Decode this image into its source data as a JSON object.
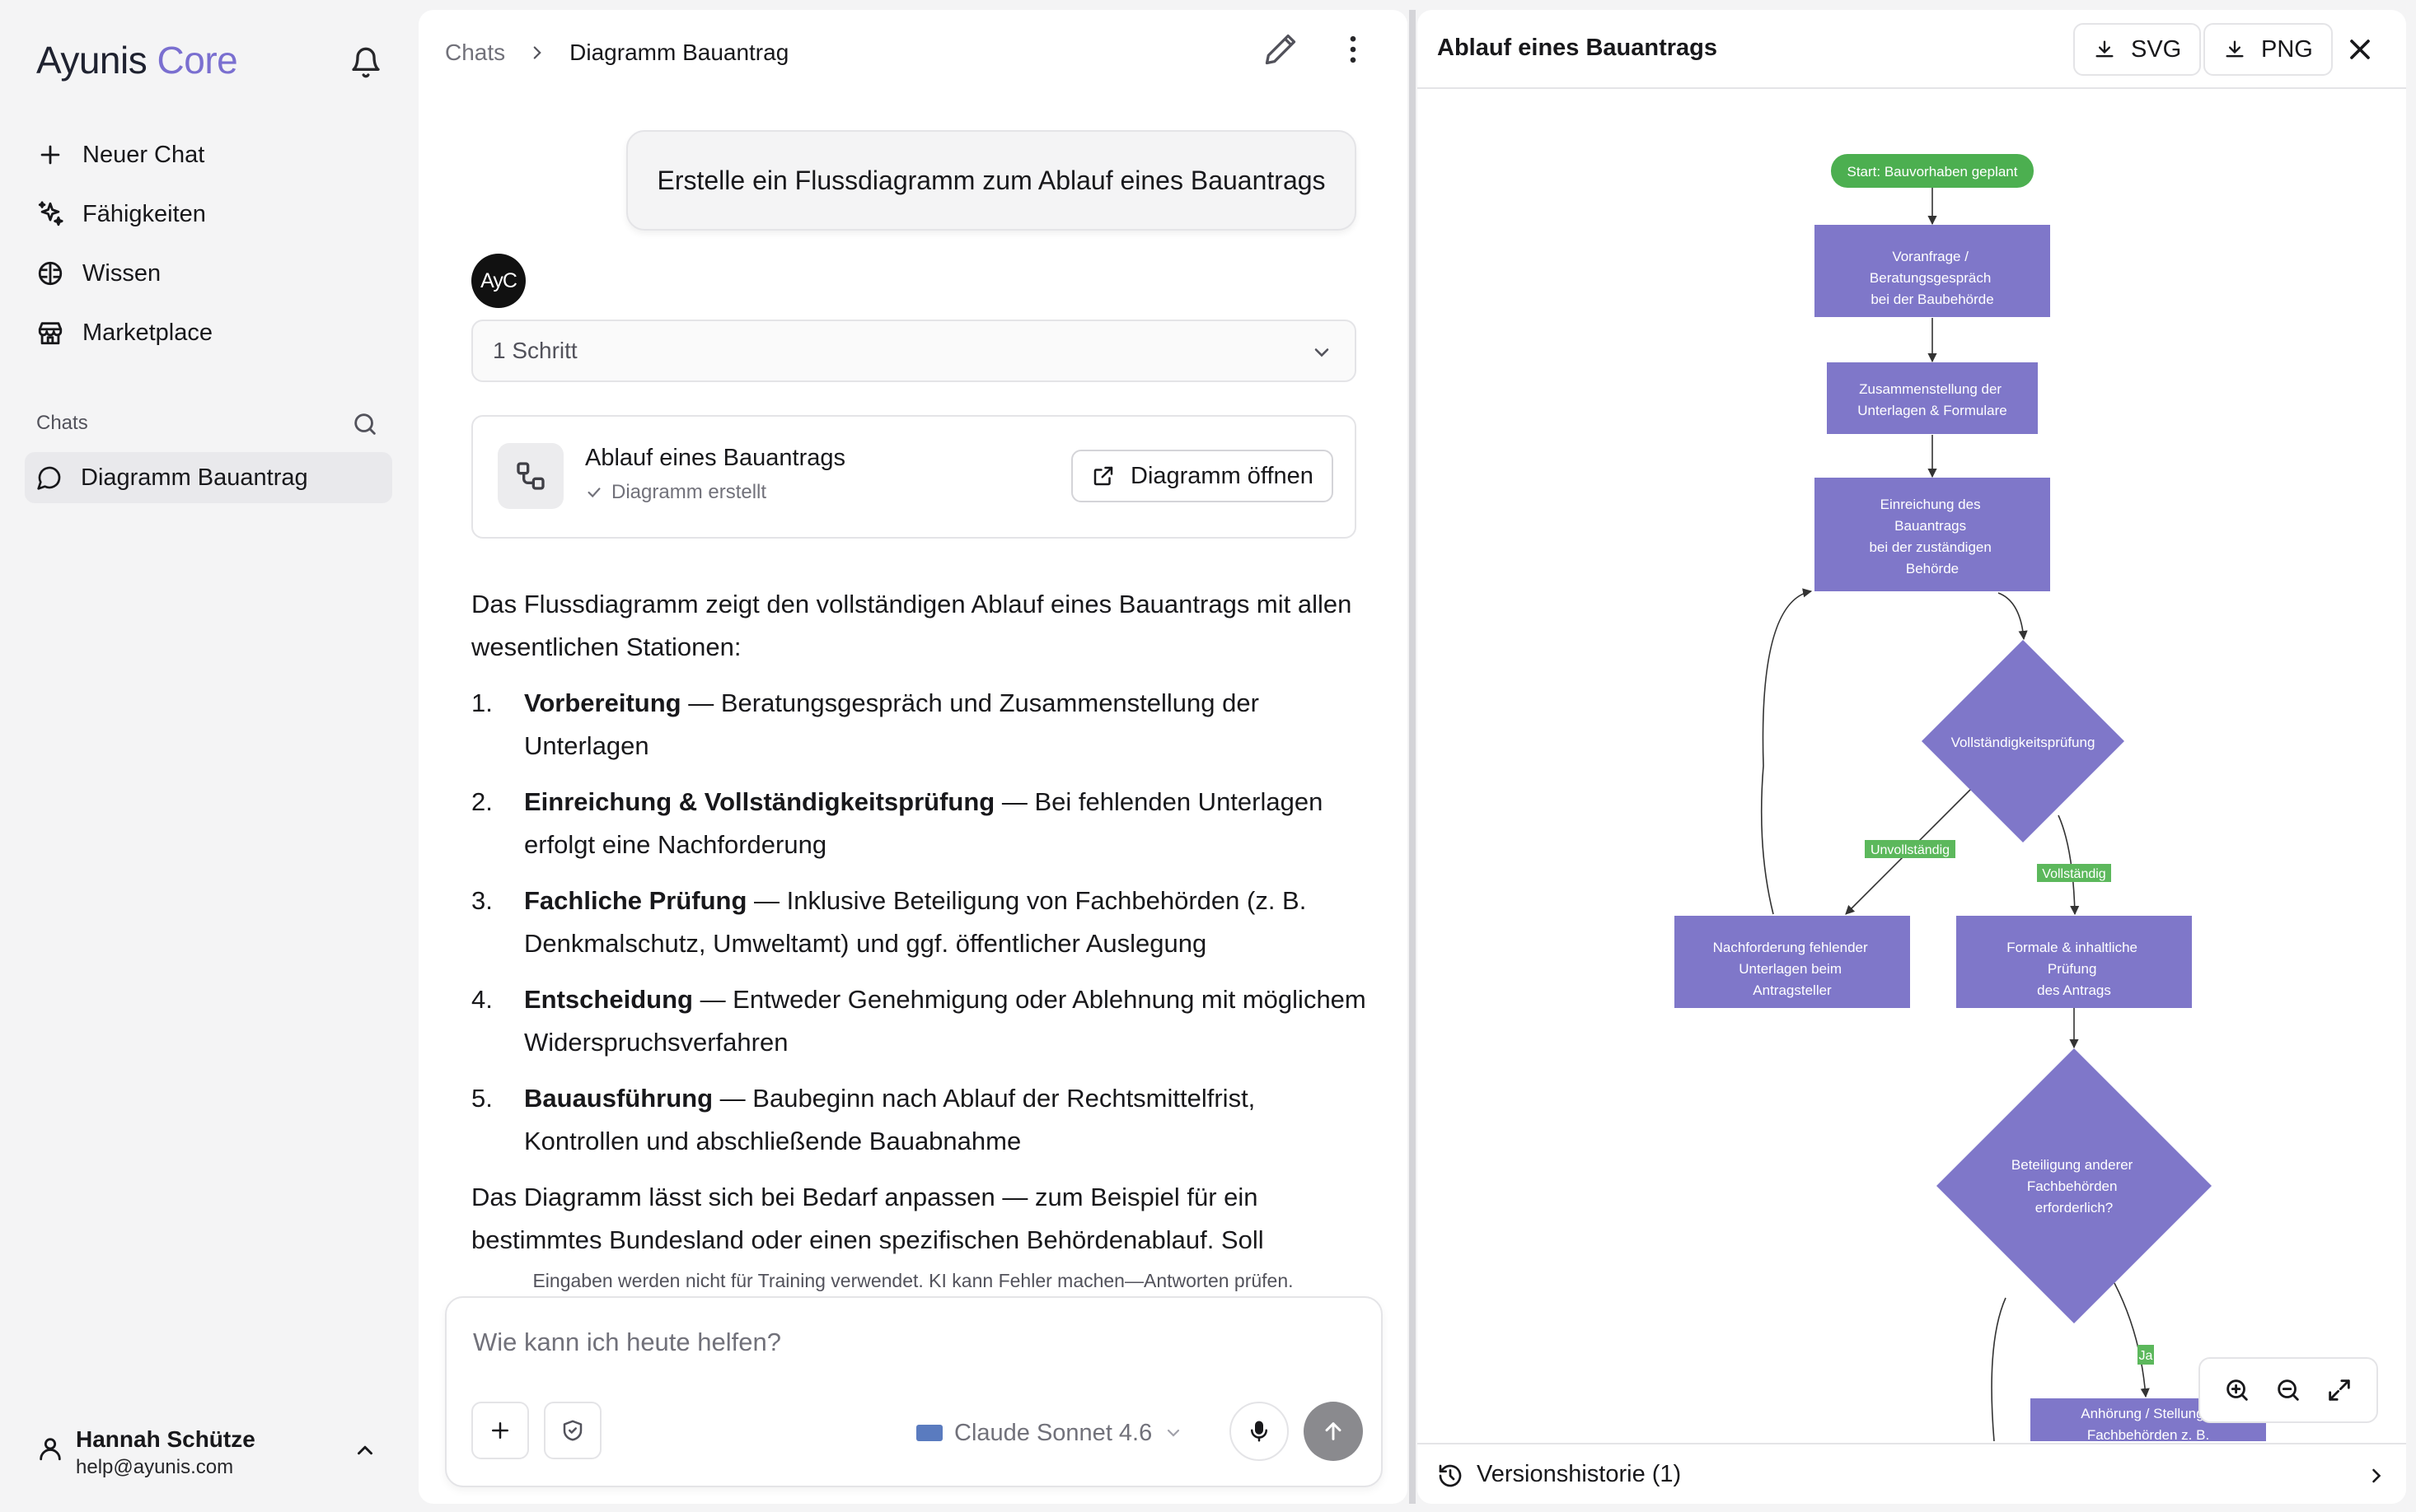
{
  "sidebar": {
    "brand_main": "Ayunis",
    "brand_accent": "Core",
    "nav": [
      {
        "label": "Neuer Chat",
        "icon": "plus-icon"
      },
      {
        "label": "Fähigkeiten",
        "icon": "sparkles-icon"
      },
      {
        "label": "Wissen",
        "icon": "brain-icon"
      },
      {
        "label": "Marketplace",
        "icon": "store-icon"
      }
    ],
    "chats_label": "Chats",
    "chats": [
      {
        "label": "Diagramm Bauantrag",
        "icon": "message-circle-icon"
      }
    ],
    "user": {
      "name": "Hannah Schütze",
      "email": "help@ayunis.com"
    }
  },
  "chat": {
    "breadcrumb": [
      "Chats",
      "Diagramm Bauantrag"
    ],
    "user_message": "Erstelle ein Flussdiagramm zum Ablauf eines Bauantrags",
    "avatar_text": "AyC",
    "steps_label": "1 Schritt",
    "tool_card": {
      "title": "Ablauf eines Bauantrags",
      "status": "Diagramm erstellt",
      "button": "Diagramm öffnen"
    },
    "answer": {
      "intro": "Das Flussdiagramm zeigt den vollständigen Ablauf eines Bauantrags mit allen wesentlichen Stationen:",
      "items": [
        {
          "num": "1.",
          "bold": "Vorbereitung",
          "text": " — Beratungsgespräch und Zusammenstellung der Unterlagen"
        },
        {
          "num": "2.",
          "bold": "Einreichung & Vollständigkeitsprüfung",
          "text": " — Bei fehlenden Unterlagen erfolgt eine Nachforderung"
        },
        {
          "num": "3.",
          "bold": "Fachliche Prüfung",
          "text": " — Inklusive Beteiligung von Fachbehörden (z. B. Denkmalschutz, Umweltamt) und ggf. öffentlicher Auslegung"
        },
        {
          "num": "4.",
          "bold": "Entscheidung",
          "text": " — Entweder Genehmigung oder Ablehnung mit möglichem Widerspruchsverfahren"
        },
        {
          "num": "5.",
          "bold": "Bauausführung",
          "text": " — Baubeginn nach Ablauf der Rechtsmittelfrist, Kontrollen und abschließende Bauabnahme"
        }
      ],
      "outro": "Das Diagramm lässt sich bei Bedarf anpassen — zum Beispiel für ein bestimmtes Bundesland oder einen spezifischen Behördenablauf. Soll"
    },
    "disclaimer": "Eingaben werden nicht für Training verwendet. KI kann Fehler machen—Antworten prüfen.",
    "composer": {
      "placeholder": "Wie kann ich heute helfen?",
      "model": "Claude Sonnet 4.6"
    }
  },
  "diagram_panel": {
    "title": "Ablauf eines Bauantrags",
    "svg_button": "SVG",
    "png_button": "PNG",
    "version_label": "Versionshistorie (1)",
    "colors": {
      "node": "#7f77c9",
      "start": "#4caf50",
      "edge": "#333333",
      "label_bg": "#5cb85c"
    },
    "nodes": {
      "start": "Start: Bauvorhaben geplant",
      "n1": [
        "Voranfrage /",
        "Beratungsgespräch",
        "bei der Baubehörde"
      ],
      "n2": [
        "Zusammenstellung der",
        "Unterlagen & Formulare"
      ],
      "n3": [
        "Einreichung des",
        "Bauantrags",
        "bei der zuständigen",
        "Behörde"
      ],
      "d1": "Vollständigkeitsprüfung",
      "n4": [
        "Nachforderung fehlender",
        "Unterlagen beim",
        "Antragsteller"
      ],
      "n5": [
        "Formale & inhaltliche",
        "Prüfung",
        "des Antrags"
      ],
      "d2": [
        "Beteiligung anderer",
        "Fachbehörden",
        "erforderlich?"
      ],
      "n6": [
        "Anhörung / Stellungn",
        "Fachbehörden z. B."
      ]
    },
    "edge_labels": {
      "unvollstaendig": "Unvollständig",
      "vollstaendig": "Vollständig",
      "ja": "Ja"
    }
  }
}
